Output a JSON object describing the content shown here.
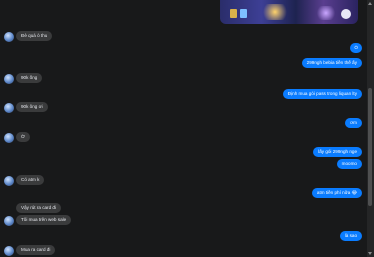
{
  "chat": {
    "shared_image_alt": "shared-image",
    "messages": [
      {
        "side": "in",
        "text": "Đè quá ò thu"
      },
      {
        "side": "out",
        "text": "Ò"
      },
      {
        "side": "out",
        "text": "299ngh bebia tiền thế ấy"
      },
      {
        "side": "in",
        "text": "90k ống"
      },
      {
        "side": "out",
        "text": "Định mua gói pass trong liquan lty"
      },
      {
        "side": "in",
        "text": "90k ông ơi"
      },
      {
        "side": "out",
        "text": "ơm"
      },
      {
        "side": "in",
        "text": "Ờ"
      },
      {
        "side": "out",
        "text": "lấy gói 299ngh nge"
      },
      {
        "side": "out",
        "text": "moomo"
      },
      {
        "side": "in",
        "text": "Có atm k"
      },
      {
        "side": "out",
        "text": "atm tiền phí nữa 😂"
      },
      {
        "side": "in",
        "text": "Vậy rút ra card đi"
      },
      {
        "side": "in",
        "text": "Tôi mua trên web sale"
      },
      {
        "side": "out",
        "text": "là sao"
      },
      {
        "side": "in",
        "text": "Mua ra card đi"
      }
    ]
  },
  "colors": {
    "background": "#18191a",
    "incoming_bubble": "#3a3b3c",
    "outgoing_bubble": "#0a7cff"
  },
  "icons": {
    "avatar": "contact-avatar-icon"
  }
}
